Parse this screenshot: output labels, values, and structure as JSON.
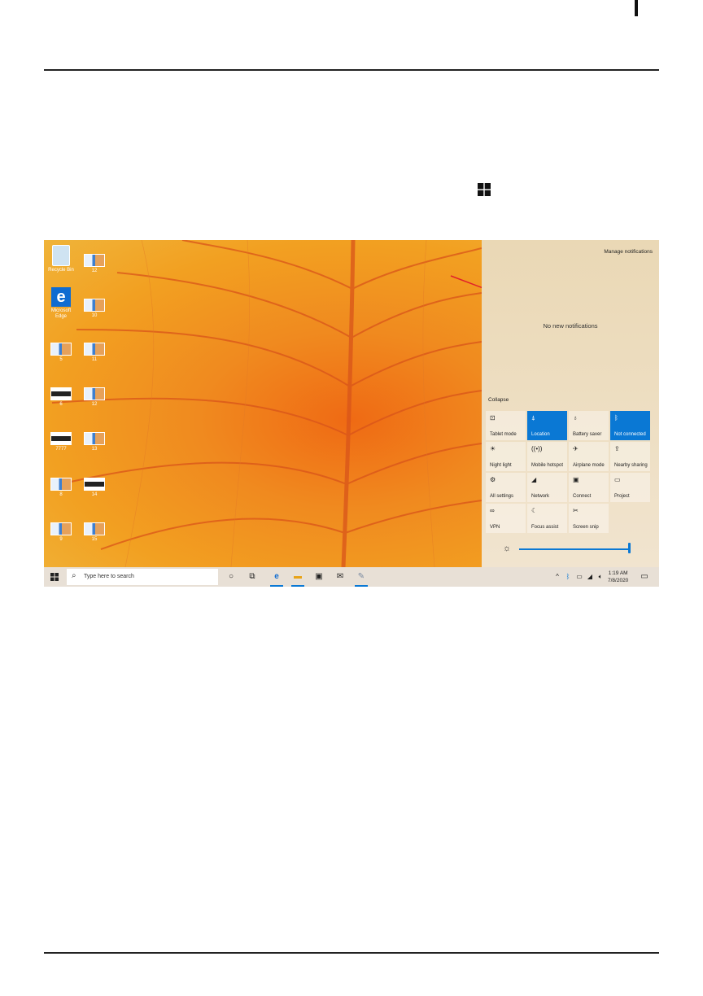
{
  "desktop": {
    "icons": [
      {
        "label": "Recycle Bin"
      },
      {
        "label": "12"
      },
      {
        "label": "Microsoft Edge"
      },
      {
        "label": "10"
      },
      {
        "label": "5"
      },
      {
        "label": "11"
      },
      {
        "label": "6"
      },
      {
        "label": "12"
      },
      {
        "label": "7777"
      },
      {
        "label": "13"
      },
      {
        "label": "8"
      },
      {
        "label": "14"
      },
      {
        "label": "9"
      },
      {
        "label": "15"
      }
    ]
  },
  "action_center": {
    "manage_label": "Manage notifications",
    "empty_label": "No new notifications",
    "collapse_label": "Collapse",
    "tiles": [
      {
        "label": "Tablet mode",
        "icon": "⊡",
        "active": false
      },
      {
        "label": "Location",
        "icon": "⍋",
        "active": true
      },
      {
        "label": "Battery saver",
        "icon": "♁",
        "active": false
      },
      {
        "label": "Not connected",
        "icon": "ᛒ",
        "active": true
      },
      {
        "label": "Night light",
        "icon": "☀",
        "active": false
      },
      {
        "label": "Mobile hotspot",
        "icon": "((•))",
        "active": false
      },
      {
        "label": "Airplane mode",
        "icon": "✈",
        "active": false
      },
      {
        "label": "Nearby sharing",
        "icon": "⇪",
        "active": false
      },
      {
        "label": "All settings",
        "icon": "⚙",
        "active": false
      },
      {
        "label": "Network",
        "icon": "◢",
        "active": false
      },
      {
        "label": "Connect",
        "icon": "▣",
        "active": false
      },
      {
        "label": "Project",
        "icon": "▭",
        "active": false
      },
      {
        "label": "VPN",
        "icon": "∞",
        "active": false
      },
      {
        "label": "Focus assist",
        "icon": "☾",
        "active": false
      },
      {
        "label": "Screen snip",
        "icon": "✂",
        "active": false
      }
    ],
    "brightness": 1.0
  },
  "taskbar": {
    "search_placeholder": "Type here to search",
    "time": "1:19 AM",
    "date": "7/8/2020"
  },
  "colors": {
    "accent": "#0a78d4",
    "annotation_arrow": "#e0202a"
  }
}
